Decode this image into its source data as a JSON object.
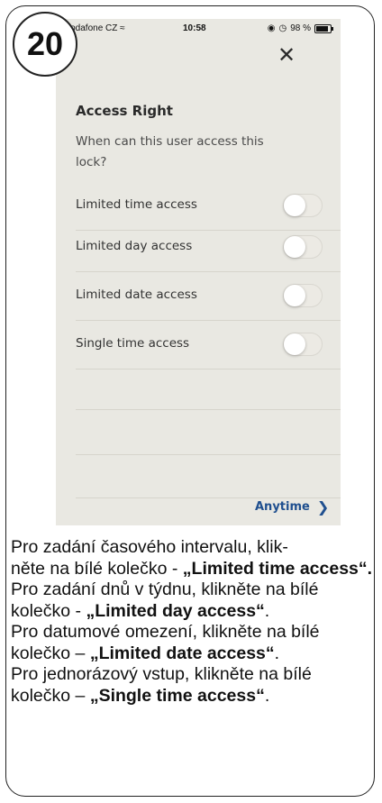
{
  "step_number": "20",
  "status_bar": {
    "carrier": "Vodafone CZ",
    "time": "10:58",
    "battery": "98 %"
  },
  "close_icon": "close-icon",
  "panel": {
    "title": "Access Right",
    "subtitle": "When can this user access this lock?",
    "options": [
      {
        "label": "Limited time access",
        "enabled": false
      },
      {
        "label": "Limited day access",
        "enabled": false
      },
      {
        "label": "Limited date access",
        "enabled": false
      },
      {
        "label": "Single time access",
        "enabled": false
      }
    ],
    "footer_label": "Anytime"
  },
  "instructions": [
    {
      "text": "Pro zadání časového intervalu, klik-\nněte na bílé kolečko - ",
      "bold": "„Limited time access“."
    },
    {
      "text": "Pro zadání dnů v týdnu, klikněte na bílé kolečko - ",
      "bold": "„Limited day access“",
      "tail": "."
    },
    {
      "text": "Pro datumové omezení, klikněte na bílé kolečko – ",
      "bold": "„Limited date access“",
      "tail": "."
    },
    {
      "text": "Pro jednorázový vstup, klikněte na bílé kolečko – ",
      "bold": "„Single time access“",
      "tail": "."
    }
  ],
  "colors": {
    "accent": "#1f4f8f",
    "phone_background": "#e9e8e2"
  }
}
